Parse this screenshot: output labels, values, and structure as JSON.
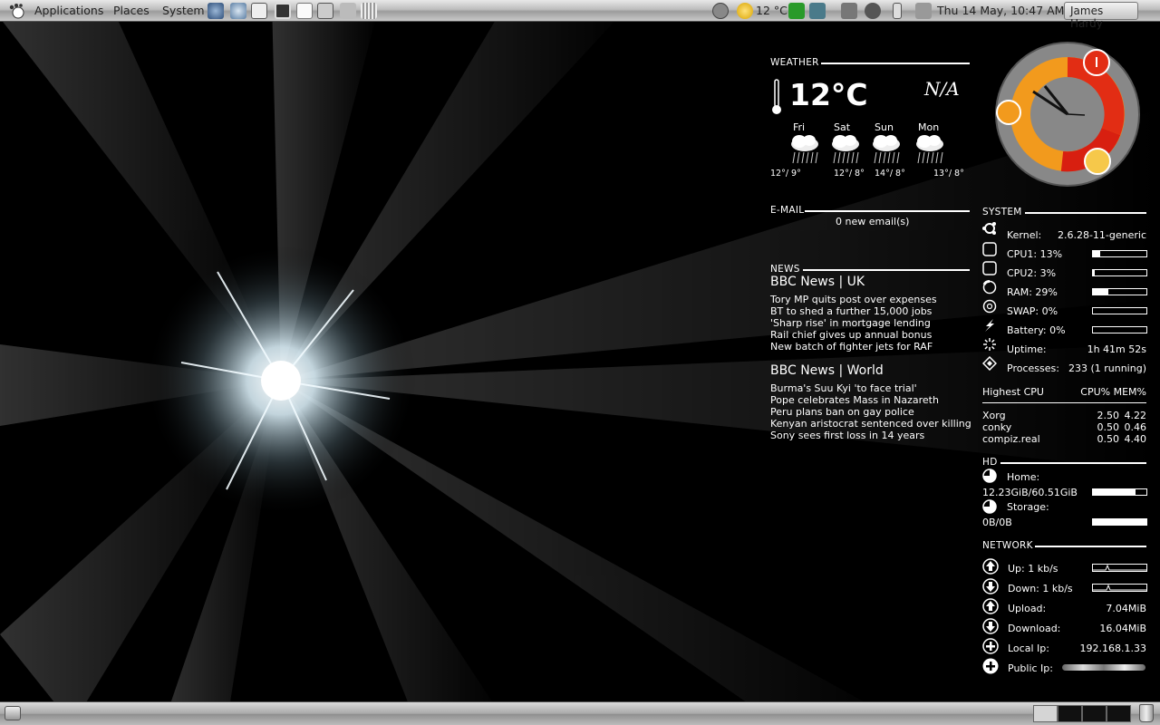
{
  "top_panel": {
    "menus": [
      "Applications",
      "Places",
      "System"
    ],
    "temperature": "12 °C",
    "clock": "Thu 14 May, 10:47 AM",
    "user": "James Hardy"
  },
  "weather": {
    "title": "WEATHER",
    "current_temp": "12°C",
    "condition": "N/A",
    "forecast": [
      {
        "day": "Fri",
        "temps": "12°/ 9°"
      },
      {
        "day": "Sat",
        "temps": "12°/ 8°"
      },
      {
        "day": "Sun",
        "temps": "14°/ 8°"
      },
      {
        "day": "Mon",
        "temps": "13°/ 8°"
      }
    ]
  },
  "email": {
    "title": "E-MAIL",
    "status": "0 new email(s)"
  },
  "news": {
    "title": "NEWS",
    "feeds": [
      {
        "name": "BBC News | UK",
        "items": [
          "Tory MP quits post over expenses",
          "BT to shed a further 15,000 jobs",
          "'Sharp rise' in mortgage lending",
          "Rail chief gives up annual bonus",
          "New batch of fighter jets for RAF"
        ]
      },
      {
        "name": "BBC News | World",
        "items": [
          "Burma's Suu Kyi 'to face trial'",
          "Pope celebrates Mass in Nazareth",
          "Peru plans ban on gay police",
          "Kenyan aristocrat sentenced over killing",
          "Sony sees first loss in 14 years"
        ]
      }
    ]
  },
  "system": {
    "title": "SYSTEM",
    "kernel_label": "Kernel:",
    "kernel": "2.6.28-11-generic",
    "cpu1": "CPU1: 13%",
    "cpu1_pct": 13,
    "cpu2": "CPU2: 3%",
    "cpu2_pct": 3,
    "ram": "RAM: 29%",
    "ram_pct": 29,
    "swap": "SWAP: 0%",
    "swap_pct": 0,
    "battery": "Battery: 0%",
    "battery_pct": 0,
    "uptime_label": "Uptime:",
    "uptime": "1h 41m 52s",
    "processes_label": "Processes:",
    "processes": "233 (1 running)",
    "top_header": "Highest CPU",
    "top_cols": "CPU% MEM%",
    "top": [
      {
        "name": "Xorg",
        "cpu": "2.50",
        "mem": "4.22"
      },
      {
        "name": "conky",
        "cpu": "0.50",
        "mem": "0.46"
      },
      {
        "name": "compiz.real",
        "cpu": "0.50",
        "mem": "4.40"
      }
    ]
  },
  "hd": {
    "title": "HD",
    "home_label": "Home:",
    "home_value": "12.23GiB/60.51GiB",
    "home_pct": 80,
    "storage_label": "Storage:",
    "storage_value": "0B/0B",
    "storage_pct": 100
  },
  "network": {
    "title": "NETWORK",
    "up": "Up: 1 kb/s",
    "down": "Down: 1 kb/s",
    "upload_label": "Upload:",
    "upload": "7.04MiB",
    "download_label": "Download:",
    "download": "16.04MiB",
    "local_ip_label": "Local Ip:",
    "local_ip": "192.168.1.33",
    "public_ip_label": "Public Ip:"
  }
}
